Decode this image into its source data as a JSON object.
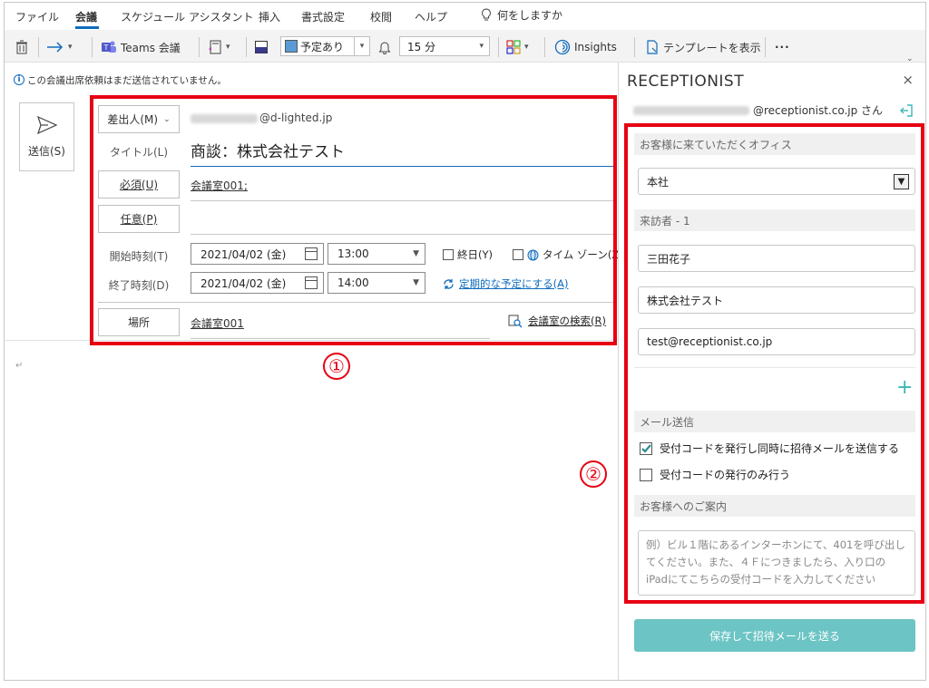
{
  "ribbon": {
    "tabs": [
      "ファイル",
      "会議",
      "スケジュール アシスタント",
      "挿入",
      "書式設定",
      "校閲",
      "ヘルプ"
    ],
    "tell_me": "何をしますか"
  },
  "toolbar": {
    "teams_label": "Teams 会議",
    "show_as": "予定あり",
    "reminder": "15 分",
    "insights_label": "Insights",
    "template_label": "テンプレートを表示",
    "more": "···"
  },
  "infobar": {
    "icon": "i",
    "message": "この会議出席依頼はまだ送信されていません。"
  },
  "send": {
    "label": "送信(S)"
  },
  "form": {
    "from_label": "差出人(M)",
    "from_value": "@d-lighted.jp",
    "title_label": "タイトル(L)",
    "title_value": "商談：株式会社テスト",
    "required_label": "必須(U)",
    "required_value": "会議室001;",
    "optional_label": "任意(P)",
    "start_label": "開始時刻(T)",
    "start_date": "2021/04/02 (金)",
    "start_time": "13:00",
    "end_label": "終了時刻(D)",
    "end_date": "2021/04/02 (金)",
    "end_time": "14:00",
    "all_day_label": "終日(Y)",
    "timezone_label": "タイム ゾーン(Z)",
    "recurring_label": "定期的な予定にする(A)",
    "location_label": "場所",
    "location_value": "会議室001",
    "room_search_label": "会議室の検索(R)",
    "paragraph_mark": "↵"
  },
  "annotations": {
    "one": "①",
    "two": "②"
  },
  "pane": {
    "title": "RECEPTIONIST",
    "close": "×",
    "user_suffix": "@receptionist.co.jp さん",
    "office_section": "お客様に来ていただくオフィス",
    "office_value": "本社",
    "visitor_section": "来訪者 - 1",
    "visitor_name": "三田花子",
    "visitor_company": "株式会社テスト",
    "visitor_email": "test@receptionist.co.jp",
    "add": "+",
    "mail_section": "メール送信",
    "option_send_invite": "受付コードを発行し同時に招待メールを送信する",
    "option_send_invite_checked": true,
    "option_code_only": "受付コードの発行のみ行う",
    "option_code_only_checked": false,
    "guide_section": "お客様へのご案内",
    "guide_placeholder": "例）ビル１階にあるインターホンにて、401を呼び出してください。また、４Ｆにつきましたら、入り口のiPadにてこちらの受付コードを入力してください",
    "save_button": "保存して招待メールを送る",
    "accent_color": "#6cc4c4"
  }
}
